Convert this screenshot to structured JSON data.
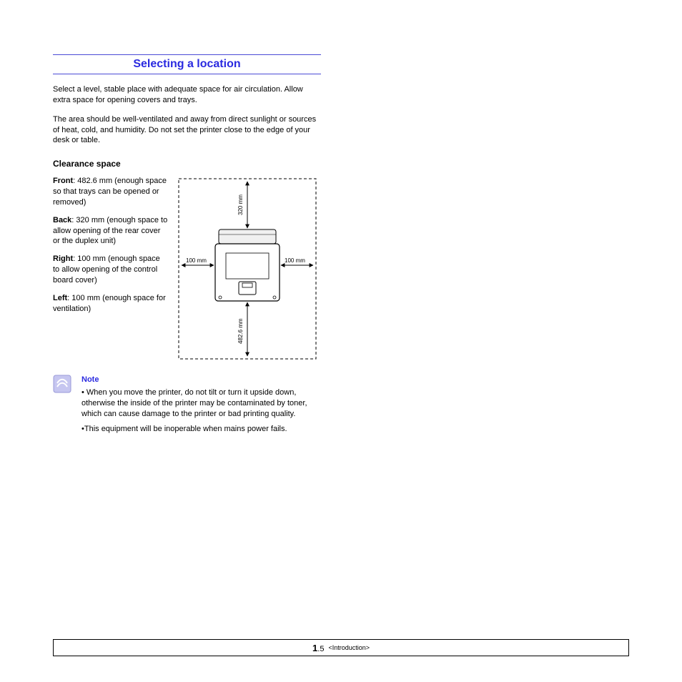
{
  "heading": "Selecting a location",
  "intro1": "Select a level, stable place with adequate space for air circulation. Allow extra space for opening covers and trays.",
  "intro2": "The area should be well-ventilated and away from direct sunlight or sources of heat, cold, and humidity. Do not set the printer close to the edge of your desk or table.",
  "sub": "Clearance space",
  "clearance": {
    "front_label": "Front",
    "front_text": ": 482.6 mm (enough space so that trays can be opened or removed)",
    "back_label": "Back",
    "back_text": ": 320 mm (enough space to allow opening of the rear cover or the duplex unit)",
    "right_label": "Right",
    "right_text": ": 100 mm (enough space to allow opening of the control board cover)",
    "left_label": "Left",
    "left_text": ": 100 mm (enough space for ventilation)"
  },
  "diagram": {
    "top": "320 mm",
    "bottom": "482.6 mm",
    "left": "100 mm",
    "right": "100 mm"
  },
  "note": {
    "label": "Note",
    "bullet1": "• When you move the printer, do not tilt or turn it upside down, otherwise the inside of the printer may be contaminated by toner, which can cause damage to the printer or bad printing quality.",
    "bullet2": "•This equipment will be inoperable when mains power fails."
  },
  "footer": {
    "chapter_num": "1",
    "dot": ".",
    "page": "5",
    "chapter_name": "<Introduction>"
  }
}
